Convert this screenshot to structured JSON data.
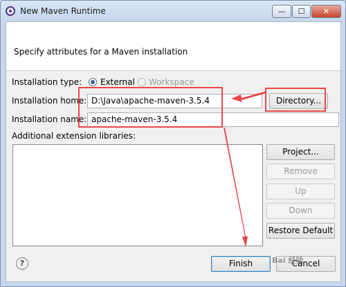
{
  "window": {
    "title": "New Maven Runtime",
    "minimize": "—",
    "maximize": "☐",
    "close": "✕"
  },
  "header": {
    "text": "Specify attributes for a Maven installation"
  },
  "form": {
    "installation_type_label": "Installation type:",
    "type_external": "External",
    "type_workspace": "Workspace",
    "installation_home_label": "Installation home:",
    "installation_home_value": "D:\\Java\\apache-maven-3.5.4",
    "installation_name_label": "Installation name:",
    "installation_name_value": "apache-maven-3.5.4",
    "additional_libs_label": "Additional extension libraries:"
  },
  "buttons": {
    "directory": "Directory...",
    "project": "Project...",
    "remove": "Remove",
    "up": "Up",
    "down": "Down",
    "restore_default": "Restore Default",
    "finish": "Finish",
    "cancel": "Cancel"
  },
  "help": "?",
  "watermark": "Bai 经验",
  "colors": {
    "annotation": "#e8474a",
    "accent": "#2a62b7"
  }
}
